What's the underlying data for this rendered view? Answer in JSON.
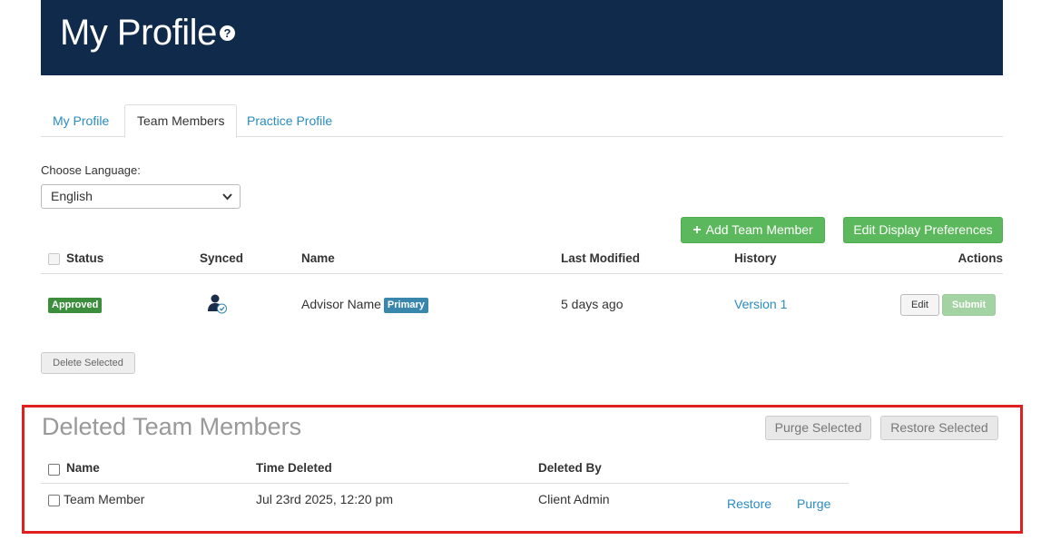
{
  "header": {
    "title": "My Profile",
    "help_icon": "?"
  },
  "tabs": [
    {
      "label": "My Profile"
    },
    {
      "label": "Team Members"
    },
    {
      "label": "Practice Profile"
    }
  ],
  "language": {
    "label": "Choose Language:",
    "value": "English"
  },
  "actions": {
    "add_member": "Add Team Member",
    "edit_prefs": "Edit Display Preferences"
  },
  "members_table": {
    "headers": {
      "status": "Status",
      "synced": "Synced",
      "name": "Name",
      "last_modified": "Last Modified",
      "history": "History",
      "actions": "Actions"
    },
    "rows": [
      {
        "status": "Approved",
        "synced_icon": "synced-user-icon",
        "name": "Advisor Name",
        "badge": "Primary",
        "last_modified": "5 days ago",
        "history": "Version 1",
        "edit": "Edit",
        "submit": "Submit"
      }
    ]
  },
  "delete_selected": "Delete Selected",
  "deleted": {
    "title": "Deleted Team Members",
    "purge_selected": "Purge Selected",
    "restore_selected": "Restore Selected",
    "headers": {
      "name": "Name",
      "time_deleted": "Time Deleted",
      "deleted_by": "Deleted By"
    },
    "rows": [
      {
        "name": "Team Member",
        "time_deleted": "Jul 23rd 2025, 12:20 pm",
        "deleted_by": "Client Admin",
        "restore": "Restore",
        "purge": "Purge"
      }
    ]
  },
  "colors": {
    "header_bg": "#0f2a4a",
    "link": "#2a8cc4",
    "green": "#5cb85c",
    "approved": "#3c8d3c",
    "primary_badge": "#3a87ad",
    "highlight_border": "#e02020"
  }
}
